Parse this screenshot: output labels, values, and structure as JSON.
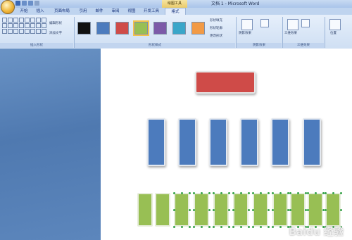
{
  "titlebar": {
    "context_tab": "绘图工具",
    "document_title": "文档 1 - Microsoft Word"
  },
  "tabs": [
    "开始",
    "插入",
    "页面布局",
    "引用",
    "邮件",
    "审阅",
    "视图",
    "开发工具",
    "格式"
  ],
  "active_tab": "格式",
  "ribbon": {
    "insert_group": {
      "edit_shape": "编辑形状",
      "add_text": "添加文字",
      "label": "插入形状"
    },
    "style_group": {
      "fill": "形状填充",
      "outline": "形状轮廓",
      "change_shape": "更改形状",
      "label": "形状样式",
      "swatch_colors": [
        "#111111",
        "#4c7bbd",
        "#cf4b48",
        "#98bf54",
        "#7c5aa8",
        "#3aa6c9",
        "#f29a45"
      ],
      "selected_swatch": 3
    },
    "shadow_group": {
      "btn": "阴影效果",
      "label": "阴影效果"
    },
    "threed_group": {
      "btn": "三维效果",
      "label": "三维效果"
    },
    "arrange_group": {
      "btn": "位置"
    }
  },
  "canvas": {
    "top_shape_color": "#cf4b48",
    "middle_shape_color": "#4c7bbd",
    "bottom_shape_color": "#98bf54",
    "middle_shape_count": 6,
    "bottom_shape_count": 11,
    "selected_bottom_count": 9
  },
  "watermark": "Baidu 经验"
}
